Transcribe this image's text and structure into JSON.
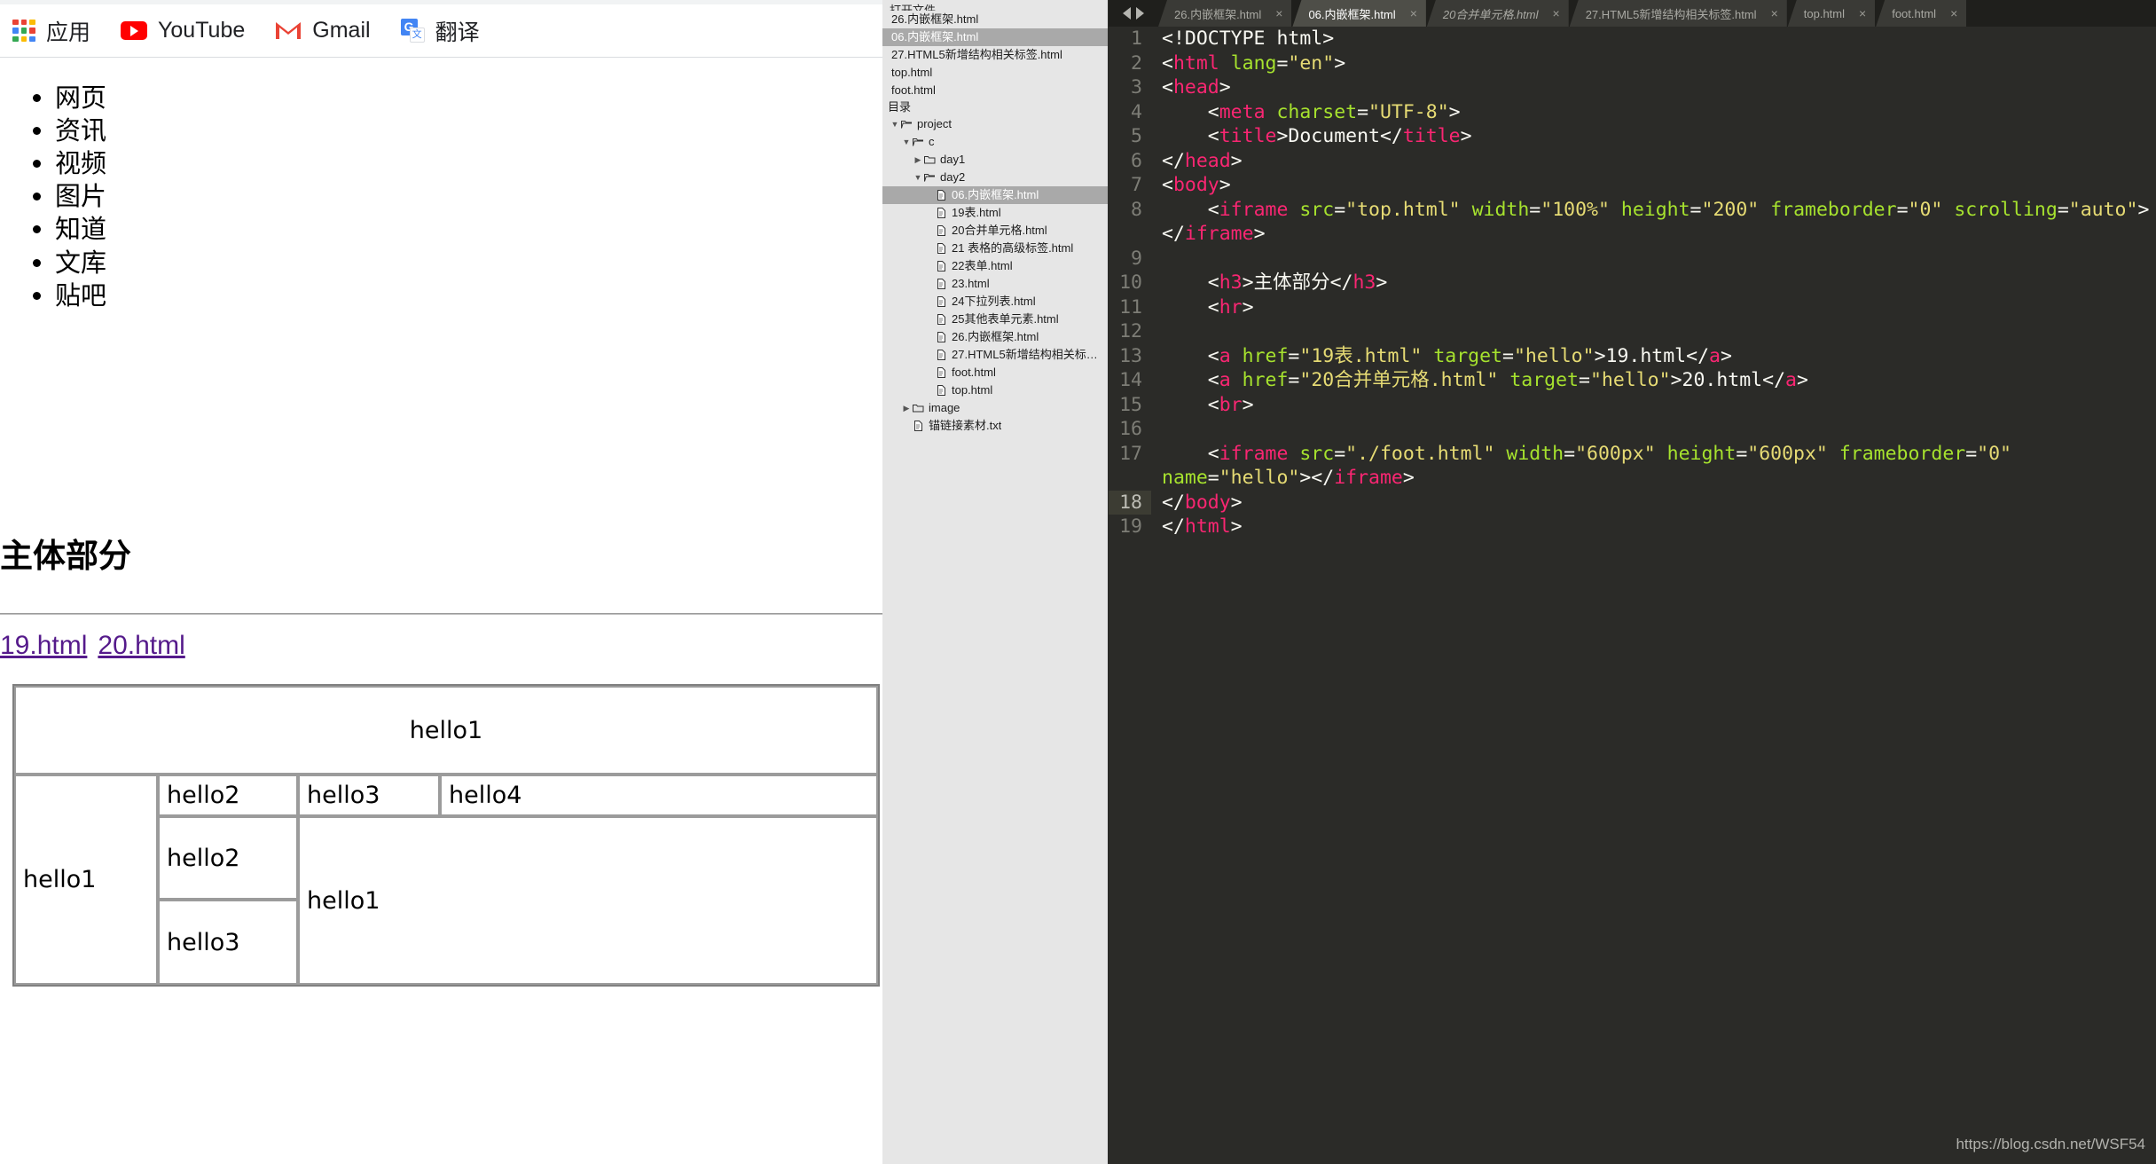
{
  "browser": {
    "bookmarks": [
      {
        "label": "应用",
        "icon": "apps-grid-icon"
      },
      {
        "label": "YouTube",
        "icon": "youtube-icon"
      },
      {
        "label": "Gmail",
        "icon": "gmail-icon"
      },
      {
        "label": "翻译",
        "icon": "translate-icon"
      }
    ],
    "page": {
      "nav_list": [
        "网页",
        "资讯",
        "视频",
        "图片",
        "知道",
        "文库",
        "贴吧"
      ],
      "heading": "主体部分",
      "links": [
        {
          "label": "19.html"
        },
        {
          "label": "20.html"
        }
      ],
      "table_top": {
        "header_cell": "hello1",
        "cells": [
          "hello2",
          "hello3",
          "hello4"
        ]
      },
      "table_bottom": {
        "left_cell": "hello1",
        "mid_cells": [
          "hello2",
          "hello3"
        ],
        "right_cell": "hello1"
      }
    }
  },
  "tree": {
    "open_files_title": "打开文件",
    "open_files": [
      {
        "label": "26.内嵌框架.html",
        "selected": false
      },
      {
        "label": "06.内嵌框架.html",
        "selected": true
      },
      {
        "label": "27.HTML5新增结构相关标签.html",
        "selected": false
      },
      {
        "label": "top.html",
        "selected": false
      },
      {
        "label": "foot.html",
        "selected": false
      }
    ],
    "folders_title": "目录",
    "nodes": [
      {
        "label": "project",
        "type": "folder",
        "depth": 0,
        "expanded": true,
        "twisty": "▼"
      },
      {
        "label": "c",
        "type": "folder",
        "depth": 1,
        "expanded": true,
        "twisty": "▼"
      },
      {
        "label": "day1",
        "type": "folder",
        "depth": 2,
        "expanded": false,
        "twisty": "▶"
      },
      {
        "label": "day2",
        "type": "folder",
        "depth": 2,
        "expanded": true,
        "twisty": "▼"
      },
      {
        "label": "06.内嵌框架.html",
        "type": "file",
        "depth": 3,
        "selected": true
      },
      {
        "label": "19表.html",
        "type": "file",
        "depth": 3
      },
      {
        "label": "20合并单元格.html",
        "type": "file",
        "depth": 3
      },
      {
        "label": "21 表格的高级标签.html",
        "type": "file",
        "depth": 3
      },
      {
        "label": "22表单.html",
        "type": "file",
        "depth": 3
      },
      {
        "label": "23.html",
        "type": "file",
        "depth": 3
      },
      {
        "label": "24下拉列表.html",
        "type": "file",
        "depth": 3
      },
      {
        "label": "25其他表单元素.html",
        "type": "file",
        "depth": 3
      },
      {
        "label": "26.内嵌框架.html",
        "type": "file",
        "depth": 3
      },
      {
        "label": "27.HTML5新增结构相关标签.html",
        "type": "file",
        "depth": 3
      },
      {
        "label": "foot.html",
        "type": "file",
        "depth": 3
      },
      {
        "label": "top.html",
        "type": "file",
        "depth": 3
      },
      {
        "label": "image",
        "type": "folder",
        "depth": 1,
        "expanded": false,
        "twisty": "▶"
      },
      {
        "label": "锚链接素材.txt",
        "type": "file",
        "depth": 1
      }
    ]
  },
  "editor": {
    "nav": {
      "prev": "◀",
      "next": "▶"
    },
    "tabs": [
      {
        "label": "26.内嵌框架.html",
        "active": false,
        "italic": false,
        "close": "×"
      },
      {
        "label": "06.内嵌框架.html",
        "active": true,
        "italic": false,
        "close": "×"
      },
      {
        "label": "20合并单元格.html",
        "active": false,
        "italic": true,
        "close": "×"
      },
      {
        "label": "27.HTML5新增结构相关标签.html",
        "active": false,
        "italic": false,
        "close": "×"
      },
      {
        "label": "top.html",
        "active": false,
        "italic": false,
        "close": "×"
      },
      {
        "label": "foot.html",
        "active": false,
        "italic": false,
        "close": "×"
      }
    ],
    "active_line": 18,
    "lines": [
      {
        "n": "1",
        "tokens": [
          {
            "t": "punc",
            "s": "<!DOCTYPE html>"
          }
        ]
      },
      {
        "n": "2",
        "tokens": [
          {
            "t": "punc",
            "s": "<"
          },
          {
            "t": "tag",
            "s": "html"
          },
          {
            "t": "punc",
            "s": " "
          },
          {
            "t": "attr",
            "s": "lang"
          },
          {
            "t": "punc",
            "s": "="
          },
          {
            "t": "val",
            "s": "\"en\""
          },
          {
            "t": "punc",
            "s": ">"
          }
        ]
      },
      {
        "n": "3",
        "tokens": [
          {
            "t": "punc",
            "s": "<"
          },
          {
            "t": "tag",
            "s": "head"
          },
          {
            "t": "punc",
            "s": ">"
          }
        ]
      },
      {
        "n": "4",
        "tokens": [
          {
            "t": "punc",
            "s": "    <"
          },
          {
            "t": "tag",
            "s": "meta"
          },
          {
            "t": "punc",
            "s": " "
          },
          {
            "t": "attr",
            "s": "charset"
          },
          {
            "t": "punc",
            "s": "="
          },
          {
            "t": "val",
            "s": "\"UTF-8\""
          },
          {
            "t": "punc",
            "s": ">"
          }
        ]
      },
      {
        "n": "5",
        "tokens": [
          {
            "t": "punc",
            "s": "    <"
          },
          {
            "t": "tag",
            "s": "title"
          },
          {
            "t": "punc",
            "s": ">"
          },
          {
            "t": "txt",
            "s": "Document"
          },
          {
            "t": "punc",
            "s": "</"
          },
          {
            "t": "tag",
            "s": "title"
          },
          {
            "t": "punc",
            "s": ">"
          }
        ]
      },
      {
        "n": "6",
        "tokens": [
          {
            "t": "punc",
            "s": "</"
          },
          {
            "t": "tag",
            "s": "head"
          },
          {
            "t": "punc",
            "s": ">"
          }
        ]
      },
      {
        "n": "7",
        "tokens": [
          {
            "t": "punc",
            "s": "<"
          },
          {
            "t": "tag",
            "s": "body"
          },
          {
            "t": "punc",
            "s": ">"
          }
        ]
      },
      {
        "n": "8",
        "tokens": [
          {
            "t": "punc",
            "s": "    <"
          },
          {
            "t": "tag",
            "s": "iframe"
          },
          {
            "t": "punc",
            "s": " "
          },
          {
            "t": "attr",
            "s": "src"
          },
          {
            "t": "punc",
            "s": "="
          },
          {
            "t": "val",
            "s": "\"top.html\""
          },
          {
            "t": "punc",
            "s": " "
          },
          {
            "t": "attr",
            "s": "width"
          },
          {
            "t": "punc",
            "s": "="
          },
          {
            "t": "val",
            "s": "\"100%\""
          },
          {
            "t": "punc",
            "s": " "
          },
          {
            "t": "attr",
            "s": "height"
          },
          {
            "t": "punc",
            "s": "="
          },
          {
            "t": "val",
            "s": "\"200\""
          },
          {
            "t": "punc",
            "s": " "
          },
          {
            "t": "attr",
            "s": "frameborder"
          },
          {
            "t": "punc",
            "s": "="
          },
          {
            "t": "val",
            "s": "\"0\""
          },
          {
            "t": "punc",
            "s": " "
          },
          {
            "t": "attr",
            "s": "scrolling"
          },
          {
            "t": "punc",
            "s": "="
          },
          {
            "t": "val",
            "s": "\"auto\""
          },
          {
            "t": "punc",
            "s": "></"
          },
          {
            "t": "tag",
            "s": "iframe"
          },
          {
            "t": "punc",
            "s": ">"
          }
        ]
      },
      {
        "n": "9",
        "tokens": []
      },
      {
        "n": "10",
        "tokens": [
          {
            "t": "punc",
            "s": "    <"
          },
          {
            "t": "tag",
            "s": "h3"
          },
          {
            "t": "punc",
            "s": ">"
          },
          {
            "t": "txt",
            "s": "主体部分"
          },
          {
            "t": "punc",
            "s": "</"
          },
          {
            "t": "tag",
            "s": "h3"
          },
          {
            "t": "punc",
            "s": ">"
          }
        ]
      },
      {
        "n": "11",
        "tokens": [
          {
            "t": "punc",
            "s": "    <"
          },
          {
            "t": "tag",
            "s": "hr"
          },
          {
            "t": "punc",
            "s": ">"
          }
        ]
      },
      {
        "n": "12",
        "tokens": []
      },
      {
        "n": "13",
        "tokens": [
          {
            "t": "punc",
            "s": "    <"
          },
          {
            "t": "tag",
            "s": "a"
          },
          {
            "t": "punc",
            "s": " "
          },
          {
            "t": "attr",
            "s": "href"
          },
          {
            "t": "punc",
            "s": "="
          },
          {
            "t": "val",
            "s": "\"19表.html\""
          },
          {
            "t": "punc",
            "s": " "
          },
          {
            "t": "attr",
            "s": "target"
          },
          {
            "t": "punc",
            "s": "="
          },
          {
            "t": "val",
            "s": "\"hello\""
          },
          {
            "t": "punc",
            "s": ">"
          },
          {
            "t": "txt",
            "s": "19.html"
          },
          {
            "t": "punc",
            "s": "</"
          },
          {
            "t": "tag",
            "s": "a"
          },
          {
            "t": "punc",
            "s": ">"
          }
        ]
      },
      {
        "n": "14",
        "tokens": [
          {
            "t": "punc",
            "s": "    <"
          },
          {
            "t": "tag",
            "s": "a"
          },
          {
            "t": "punc",
            "s": " "
          },
          {
            "t": "attr",
            "s": "href"
          },
          {
            "t": "punc",
            "s": "="
          },
          {
            "t": "val",
            "s": "\"20合并单元格.html\""
          },
          {
            "t": "punc",
            "s": " "
          },
          {
            "t": "attr",
            "s": "target"
          },
          {
            "t": "punc",
            "s": "="
          },
          {
            "t": "val",
            "s": "\"hello\""
          },
          {
            "t": "punc",
            "s": ">"
          },
          {
            "t": "txt",
            "s": "20.html"
          },
          {
            "t": "punc",
            "s": "</"
          },
          {
            "t": "tag",
            "s": "a"
          },
          {
            "t": "punc",
            "s": ">"
          }
        ]
      },
      {
        "n": "15",
        "tokens": [
          {
            "t": "punc",
            "s": "    <"
          },
          {
            "t": "tag",
            "s": "br"
          },
          {
            "t": "punc",
            "s": ">"
          }
        ]
      },
      {
        "n": "16",
        "tokens": []
      },
      {
        "n": "17",
        "tokens": [
          {
            "t": "punc",
            "s": "    <"
          },
          {
            "t": "tag",
            "s": "iframe"
          },
          {
            "t": "punc",
            "s": " "
          },
          {
            "t": "attr",
            "s": "src"
          },
          {
            "t": "punc",
            "s": "="
          },
          {
            "t": "val",
            "s": "\"./foot.html\""
          },
          {
            "t": "punc",
            "s": " "
          },
          {
            "t": "attr",
            "s": "width"
          },
          {
            "t": "punc",
            "s": "="
          },
          {
            "t": "val",
            "s": "\"600px\""
          },
          {
            "t": "punc",
            "s": " "
          },
          {
            "t": "attr",
            "s": "height"
          },
          {
            "t": "punc",
            "s": "="
          },
          {
            "t": "val",
            "s": "\"600px\""
          },
          {
            "t": "punc",
            "s": " "
          },
          {
            "t": "attr",
            "s": "frameborder"
          },
          {
            "t": "punc",
            "s": "="
          },
          {
            "t": "val",
            "s": "\"0\""
          },
          {
            "t": "punc",
            "s": " "
          },
          {
            "t": "attr",
            "s": "name"
          },
          {
            "t": "punc",
            "s": "="
          },
          {
            "t": "val",
            "s": "\"hello\""
          },
          {
            "t": "punc",
            "s": "></"
          },
          {
            "t": "tag",
            "s": "iframe"
          },
          {
            "t": "punc",
            "s": ">"
          }
        ]
      },
      {
        "n": "18",
        "tokens": [
          {
            "t": "punc",
            "s": "</"
          },
          {
            "t": "tag",
            "s": "body"
          },
          {
            "t": "punc",
            "s": ">"
          }
        ]
      },
      {
        "n": "19",
        "tokens": [
          {
            "t": "punc",
            "s": "</"
          },
          {
            "t": "tag",
            "s": "html"
          },
          {
            "t": "punc",
            "s": ">"
          }
        ]
      }
    ]
  },
  "watermark": "https://blog.csdn.net/WSF54",
  "colors": {
    "tag": "#f92672",
    "attr": "#a6e22e",
    "value": "#e6db74",
    "editor_bg": "#2b2b28",
    "tree_bg": "#e6e6e6",
    "link_visited": "#551a8b"
  }
}
